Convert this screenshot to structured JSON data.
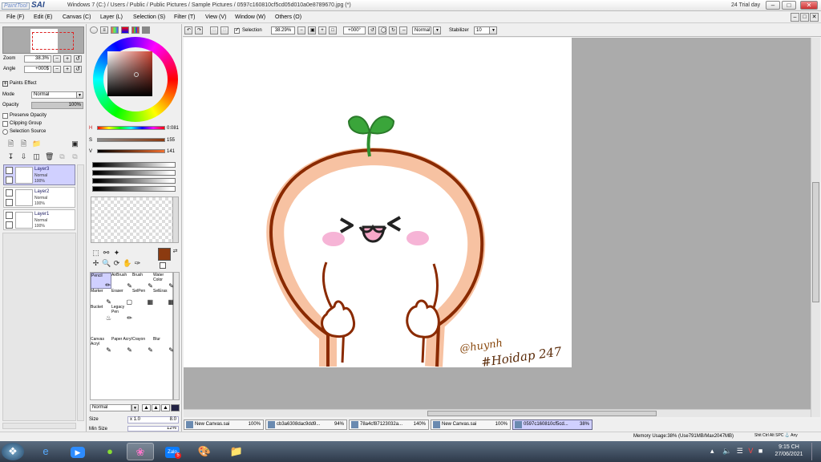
{
  "window": {
    "app_name_small": "PaintTool",
    "app_name": "SAI",
    "title_path": "Windows 7 (C:) / Users / Public / Public Pictures / Sample Pictures / 0597c160810cf5cd05d010a0e8789670.jpg (*)",
    "trial": "24 Trial day",
    "minimize": "–",
    "maximize": "□",
    "close": "✕"
  },
  "menu": [
    {
      "label": "File (F)"
    },
    {
      "label": "Edit (E)"
    },
    {
      "label": "Canvas (C)"
    },
    {
      "label": "Layer (L)"
    },
    {
      "label": "Selection (S)"
    },
    {
      "label": "Filter (T)"
    },
    {
      "label": "View (V)"
    },
    {
      "label": "Window (W)"
    },
    {
      "label": "Others (O)"
    }
  ],
  "navigator": {
    "zoom_label": "Zoom",
    "zoom_value": "38.3%",
    "angle_label": "Angle",
    "angle_value": "+000$",
    "minus": "−",
    "plus": "+",
    "reset": "↺"
  },
  "layer_props": {
    "paints_effect": "Paints Effect",
    "mode_label": "Mode",
    "mode_value": "Normal",
    "opacity_label": "Opacity",
    "opacity_value": "100%",
    "opacity_fill": 1.0,
    "preserve_opacity": "Preserve Opacity",
    "clipping_group": "Clipping Group",
    "selection_source": "Selection Source"
  },
  "layers": [
    {
      "name": "Layer3",
      "mode": "Normal",
      "opacity": "100%",
      "selected": true
    },
    {
      "name": "Layer2",
      "mode": "Normal",
      "opacity": "100%",
      "selected": false
    },
    {
      "name": "Layer1",
      "mode": "Normal",
      "opacity": "100%",
      "selected": false
    }
  ],
  "color": {
    "h_label": "H",
    "h_value": "0:081",
    "s_label": "S",
    "s_value": "155",
    "v_label": "V",
    "v_value": "141",
    "current": "#8b3a10"
  },
  "brush_tools": {
    "items": [
      {
        "label": "Pencil",
        "selected": true
      },
      {
        "label": "AirBrush"
      },
      {
        "label": "Brush"
      },
      {
        "label": "Water Color"
      },
      {
        "label": "Marker"
      },
      {
        "label": "Eraser"
      },
      {
        "label": "SelPen"
      },
      {
        "label": "SelEras"
      },
      {
        "label": "Bucket"
      },
      {
        "label": "Legacy Pen"
      },
      {
        "label": "Canvas Acryl"
      },
      {
        "label": "Paper Acryl"
      },
      {
        "label": "Crayon"
      },
      {
        "label": "Blur"
      }
    ],
    "blend_mode": "Normal",
    "size_label": "Size",
    "size_mult": "x 1.0",
    "size_value": "8.0",
    "min_size_label": "Min Size",
    "min_size_value": "12%"
  },
  "toolbar": {
    "selection_label": "Selection",
    "zoom_value": "38.29%",
    "angle_value": "+000°",
    "blend_value": "Normal",
    "stabilizer_label": "Stabilizer",
    "stabilizer_value": "10"
  },
  "canvas": {
    "signature_line1": "@huynh",
    "signature_line2": "#Hoidap 247"
  },
  "doc_tabs": [
    {
      "name": "New Canvas.sai",
      "zoom": "100%",
      "selected": false
    },
    {
      "name": "cb3a6308dac9dd9...",
      "zoom": "94%",
      "selected": false
    },
    {
      "name": "78a4cf87123032a...",
      "zoom": "140%",
      "selected": false
    },
    {
      "name": "New Canvas.sai",
      "zoom": "100%",
      "selected": false
    },
    {
      "name": "0597c160810cf5cd...",
      "zoom": "38%",
      "selected": true
    }
  ],
  "status": {
    "memory": "Memory Usage:38% (Use791MB/Max2047MB)",
    "flags": "Shit Ctrl Alt SPC ⚓ Any"
  },
  "taskbar": {
    "time": "9:15 CH",
    "date": "27/06/2021",
    "zalo_badge": "5"
  }
}
